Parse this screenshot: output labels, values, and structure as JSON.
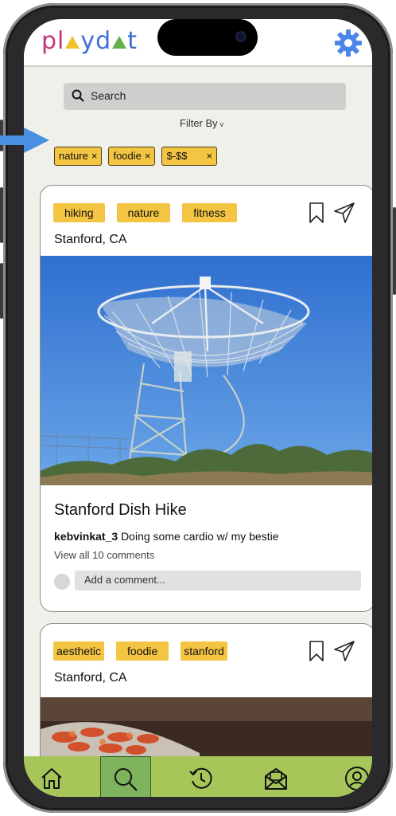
{
  "app": {
    "logo_text": "playdate",
    "settings_icon": "gear-icon"
  },
  "search": {
    "placeholder": "Search"
  },
  "filter": {
    "label": "Filter By",
    "chips": [
      {
        "label": "nature",
        "remove": "×"
      },
      {
        "label": "foodie",
        "remove": "×"
      },
      {
        "label": "$-$$",
        "remove": "×"
      }
    ]
  },
  "posts": [
    {
      "tags": [
        "hiking",
        "nature",
        "fitness"
      ],
      "location": "Stanford, CA",
      "title": "Stanford Dish Hike",
      "author": "kebvinkat_3",
      "caption": "Doing some cardio w/ my bestie",
      "comments_link": "View all 10 comments",
      "comment_placeholder": "Add a comment..."
    },
    {
      "tags": [
        "aesthetic",
        "foodie",
        "stanford"
      ],
      "location": "Stanford, CA"
    }
  ],
  "nav": {
    "items": [
      "home-icon",
      "search-icon",
      "history-icon",
      "inbox-icon",
      "profile-icon"
    ],
    "active": "search"
  },
  "colors": {
    "tag": "#f4c542",
    "nav": "#a6c65a",
    "nav_active": "#7fb25d",
    "accent_blue": "#3f6fd7",
    "pink": "#c4357d",
    "green": "#64b24c"
  }
}
